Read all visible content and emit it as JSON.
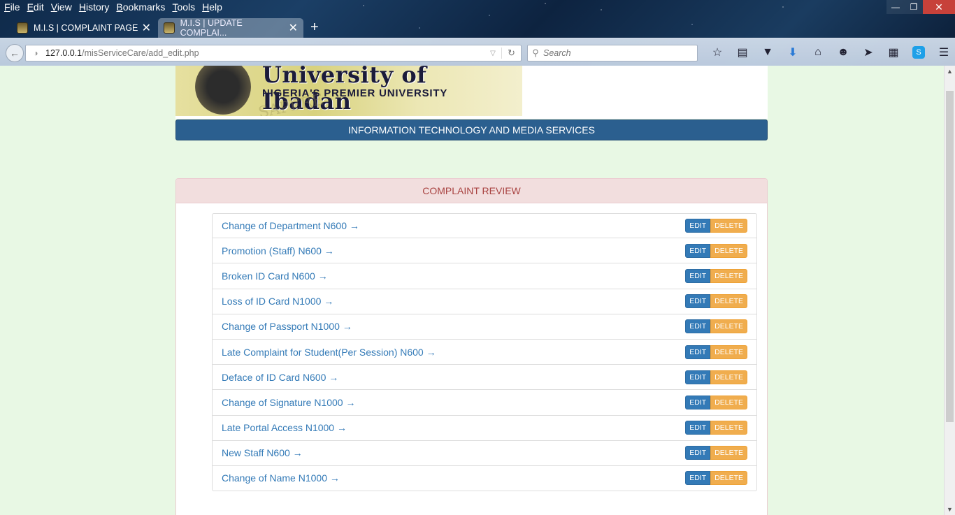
{
  "browser": {
    "menu": [
      "File",
      "Edit",
      "View",
      "History",
      "Bookmarks",
      "Tools",
      "Help"
    ],
    "tabs": [
      {
        "title": "M.I.S | COMPLAINT PAGE"
      },
      {
        "title": "M.I.S | UPDATE COMPLAI..."
      }
    ],
    "url_host": "127.0.0.1",
    "url_path": "/misServiceCare/add_edit.php",
    "search_placeholder": "Search"
  },
  "page": {
    "university_name": "University of Ibadan",
    "university_tagline": "NIGERIA'S PREMIER UNIVERSITY",
    "banner_motto": "SAPERE",
    "department": "INFORMATION TECHNOLOGY AND MEDIA SERVICES",
    "panel_title": "COMPLAINT REVIEW",
    "edit_label": "EDIT",
    "delete_label": "DELETE",
    "complaints": [
      "Change of Department N600 →",
      "Promotion (Staff) N600 →",
      "Broken ID Card N600 →",
      "Loss of ID Card N1000 →",
      "Change of Passport N1000 →",
      "Late Complaint for Student(Per Session) N600 →",
      "Deface of ID Card N600 →",
      "Change of Signature N1000 →",
      "Late Portal Access N1000 →",
      "New Staff N600 →",
      "Change of Name N1000 →"
    ]
  },
  "colors": {
    "page_bg": "#e8f8e4",
    "header_bar": "#2b5f8f",
    "panel_head_bg": "#f2dede",
    "panel_head_text": "#a94442",
    "link": "#337ab7",
    "edit_btn": "#337ab7",
    "delete_btn": "#f0ad4e"
  }
}
